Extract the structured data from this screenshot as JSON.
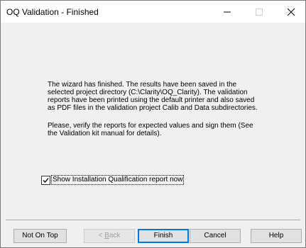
{
  "window": {
    "title": "OQ Validation - Finished"
  },
  "titlebar_buttons": {
    "minimize_icon": "minimize-icon",
    "maximize_icon": "maximize-icon",
    "close_icon": "close-icon"
  },
  "message": {
    "paragraph1": "The wizard has finished. The results have been saved in the selected project directory (C:\\Clarity\\OQ_Clarity). The validation reports have been printed using the default printer and also saved as PDF files in the validation project Calib and Data subdirectories.",
    "paragraph2": "Please, verify the reports for expected values and sign them (See the Validation kit manual for details)."
  },
  "checkbox": {
    "label": "Show Installation Qualification report now",
    "checked": true
  },
  "buttons": {
    "not_on_top": "Not On Top",
    "back": "< Back",
    "finish": "Finish",
    "cancel": "Cancel",
    "help": "Help"
  },
  "colors": {
    "dialog_bg": "#f0f0f0",
    "titlebar_bg": "#ffffff",
    "default_button_border": "#0078d7"
  }
}
